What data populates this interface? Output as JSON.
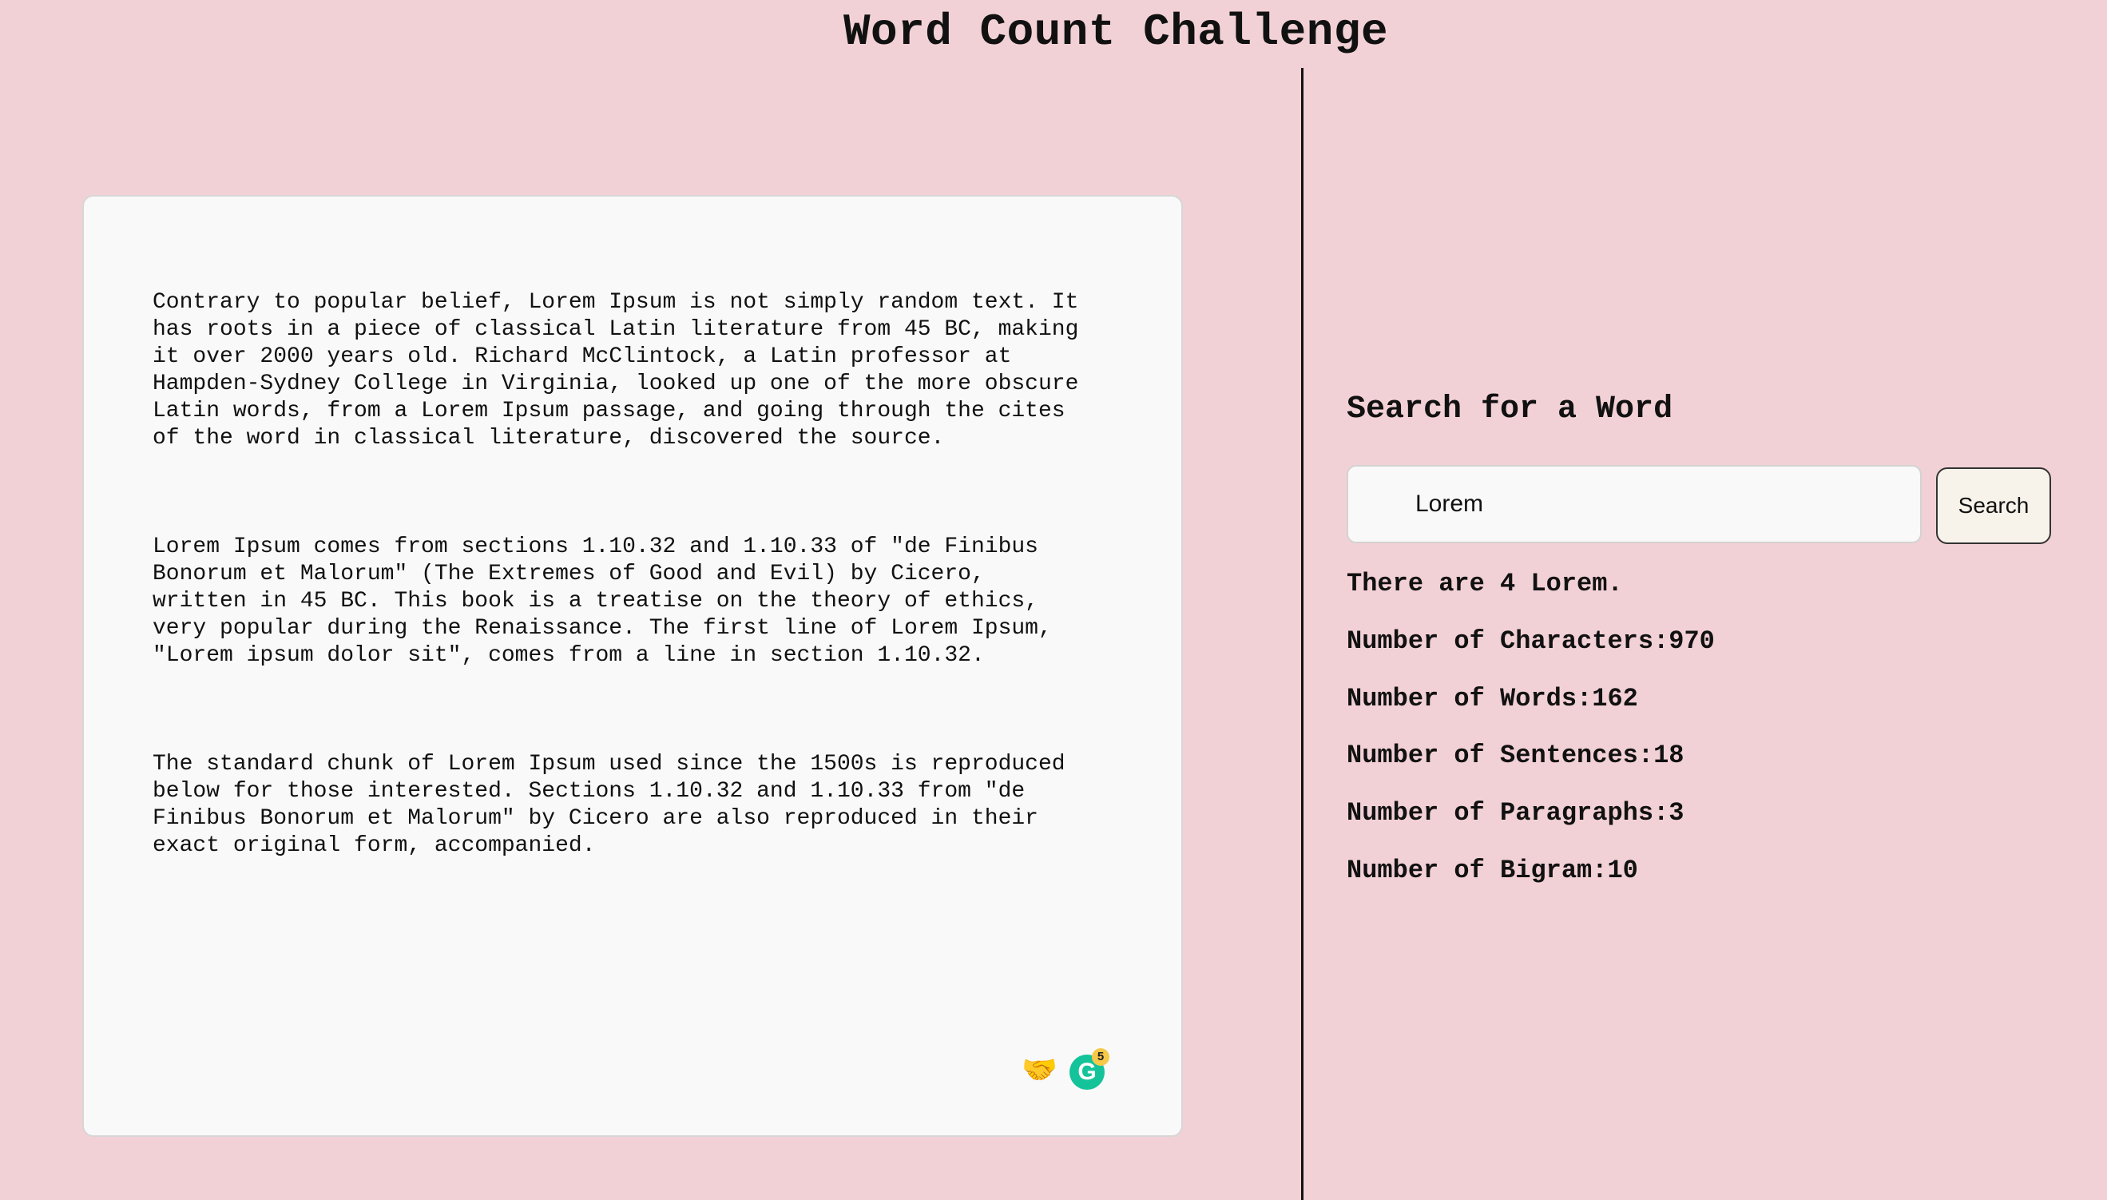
{
  "header": {
    "title": "Word Count Challenge"
  },
  "text_input": {
    "paragraphs": [
      "Contrary to popular belief, Lorem Ipsum is not simply random text. It\nhas roots in a piece of classical Latin literature from 45 BC, making\nit over 2000 years old. Richard McClintock, a Latin professor at\nHampden-Sydney College in Virginia, looked up one of the more obscure\nLatin words, from a Lorem Ipsum passage, and going through the cites\nof the word in classical literature, discovered the source.",
      "Lorem Ipsum comes from sections 1.10.32 and 1.10.33 of \"de Finibus\nBonorum et Malorum\" (The Extremes of Good and Evil) by Cicero,\nwritten in 45 BC. This book is a treatise on the theory of ethics,\nvery popular during the Renaissance. The first line of Lorem Ipsum,\n\"Lorem ipsum dolor sit\", comes from a line in section 1.10.32.",
      "The standard chunk of Lorem Ipsum used since the 1500s is reproduced\nbelow for those interested. Sections 1.10.32 and 1.10.33 from \"de\nFinibus Bonorum et Malorum\" by Cicero are also reproduced in their\nexact original form, accompanied."
    ],
    "extension_icons": {
      "emoji": "🤝",
      "grammarly_letter": "G",
      "grammarly_badge": "5"
    }
  },
  "search": {
    "heading": "Search for a Word",
    "input_value": "Lorem",
    "button_label": "Search"
  },
  "results": {
    "match_text": "There are 4 Lorem.",
    "characters": "Number of Characters:970",
    "words": "Number of Words:162",
    "sentences": "Number of Sentences:18",
    "paragraphs": "Number of Paragraphs:3",
    "bigram": "Number of Bigram:10"
  },
  "colors": {
    "background": "#f2d1d6",
    "panel": "#f9f9f9",
    "grammarly": "#15c39a"
  }
}
